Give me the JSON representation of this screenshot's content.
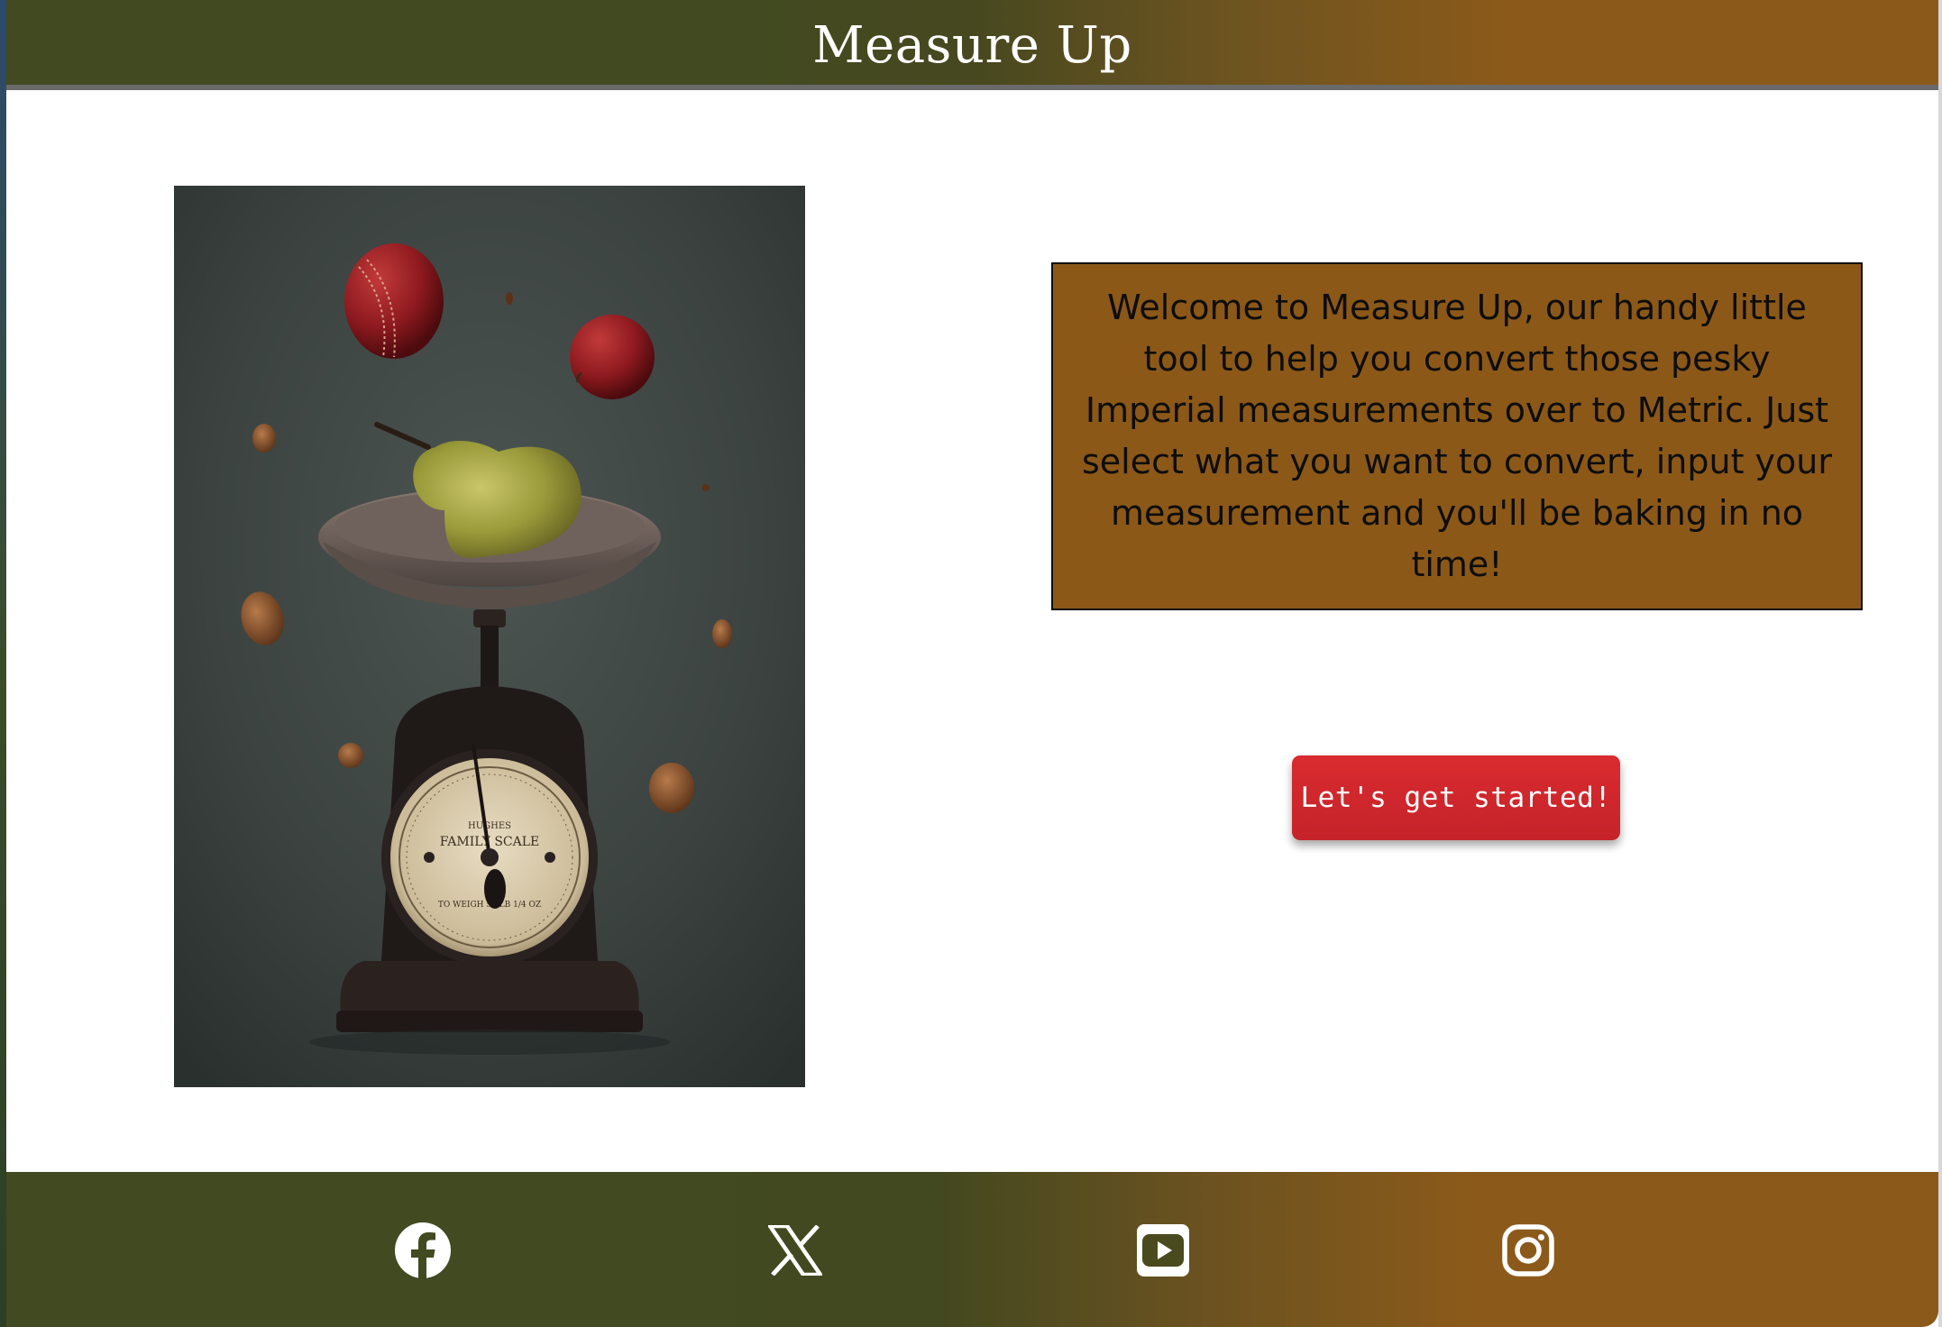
{
  "header": {
    "title": "Measure Up"
  },
  "hero": {
    "image_name": "vintage-kitchen-scale-with-pear-and-fruit",
    "scale_text": {
      "brand": "FAMILY SCALE",
      "maker": "HUGHES",
      "capacity": "TO WEIGH 56 LB 1/4 OZ"
    }
  },
  "welcome": {
    "text": "Welcome to Measure Up, our handy little tool to help you convert those pesky Imperial measurements over to Metric. Just select what you want to convert, input your measurement and you'll be baking in no time!"
  },
  "cta": {
    "label": "Let's get started!"
  },
  "footer": {
    "social": [
      {
        "name": "facebook",
        "icon": "facebook-icon"
      },
      {
        "name": "x",
        "icon": "x-icon"
      },
      {
        "name": "youtube",
        "icon": "youtube-icon"
      },
      {
        "name": "instagram",
        "icon": "instagram-icon"
      }
    ]
  },
  "colors": {
    "header_green": "#414a21",
    "header_brown": "#8b5a1a",
    "welcome_bg": "#8b5818",
    "cta_red": "#d92b2f"
  }
}
